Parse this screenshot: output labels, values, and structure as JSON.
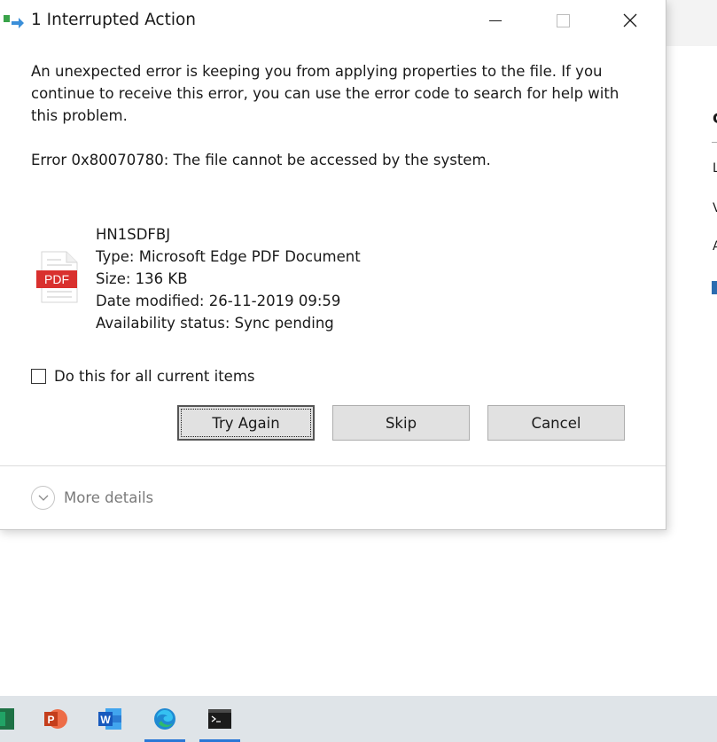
{
  "dialog": {
    "title": "1 Interrupted Action",
    "message": "An unexpected error is keeping you from applying properties to the file. If you continue to receive this error, you can use the error code to search for help with this problem.",
    "error": "Error 0x80070780: The file cannot be accessed by the system.",
    "file": {
      "name": "HN1SDFBJ",
      "type": "Type: Microsoft Edge PDF Document",
      "size": "Size: 136 KB",
      "date_modified": "Date modified: 26-11-2019 09:59",
      "availability": "Availability status: Sync pending",
      "icon_label": "PDF"
    },
    "checkbox_label": "Do this for all current items",
    "buttons": {
      "try_again": "Try Again",
      "skip": "Skip",
      "cancel": "Cancel"
    },
    "more_details": "More details"
  },
  "background_window": {
    "right_pane_letters": [
      "C",
      "L",
      "V",
      "A"
    ]
  },
  "taskbar": {
    "items": [
      "excel-icon",
      "powerpoint-icon",
      "word-icon",
      "edge-icon",
      "terminal-icon"
    ]
  },
  "colors": {
    "pdf_red": "#d9302e",
    "taskbar_bg": "#dfe4e8",
    "active_underline": "#2a78d6"
  }
}
